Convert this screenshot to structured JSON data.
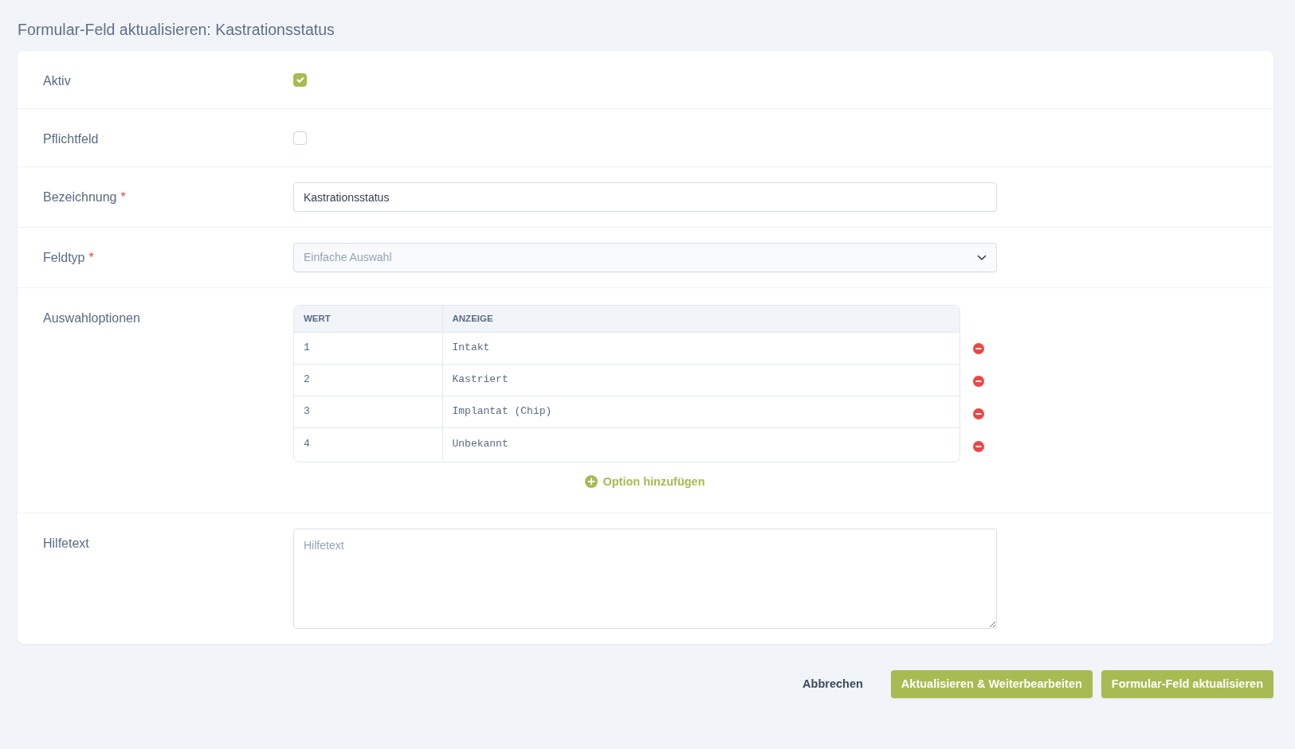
{
  "page": {
    "title": "Formular-Feld aktualisieren: Kastrationsstatus"
  },
  "fields": [
    {
      "kind": "checkbox",
      "label": "Aktiv",
      "checked": true
    },
    {
      "kind": "checkbox",
      "label": "Pflichtfeld",
      "checked": false
    },
    {
      "kind": "text",
      "label": "Bezeichnung",
      "required_mark": "*",
      "value": "Kastrationsstatus"
    },
    {
      "kind": "select",
      "label": "Feldtyp",
      "required_mark": "*",
      "value": "Einfache Auswahl",
      "disabled": true
    },
    {
      "kind": "options",
      "label": "Auswahloptionen",
      "columns": [
        "WERT",
        "ANZEIGE"
      ],
      "rows": [
        {
          "value": "1",
          "display": "Intakt"
        },
        {
          "value": "2",
          "display": "Kastriert"
        },
        {
          "value": "3",
          "display": "Implantat (Chip)"
        },
        {
          "value": "4",
          "display": "Unbekannt"
        }
      ],
      "add_label": "Option hinzufügen"
    },
    {
      "kind": "textarea",
      "label": "Hilfetext",
      "placeholder": "Hilfetext"
    }
  ],
  "actions": [
    {
      "kind": "link",
      "label": "Abbrechen"
    },
    {
      "kind": "primary",
      "label": "Aktualisieren & Weiterbearbeiten"
    },
    {
      "kind": "primary",
      "label": "Formular-Feld aktualisieren"
    }
  ]
}
